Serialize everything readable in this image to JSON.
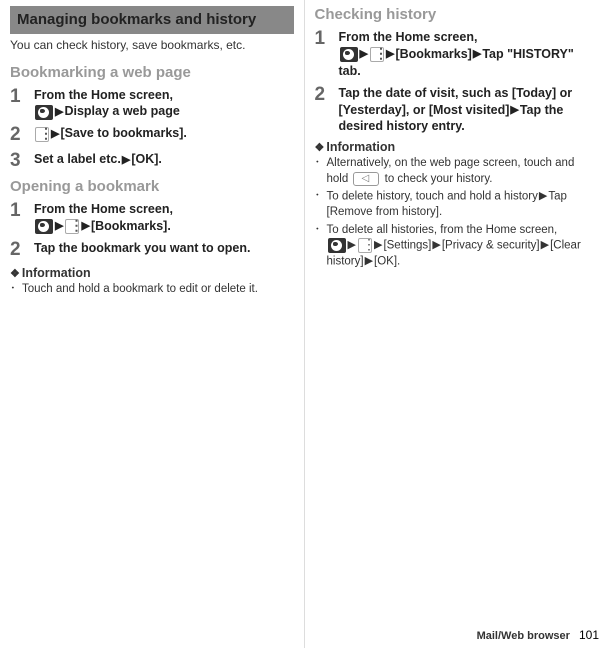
{
  "left": {
    "sectionTitle": "Managing bookmarks and history",
    "intro": "You can check history, save bookmarks, etc.",
    "sub1": "Bookmarking a web page",
    "steps1": {
      "s1a": "From the Home screen, ",
      "s1b": "Display a web page",
      "s2": "[Save to bookmarks].",
      "s3a": "Set a label etc.",
      "s3b": "[OK]."
    },
    "sub2": "Opening a bookmark",
    "steps2": {
      "s1a": "From the Home screen, ",
      "s1b": "[Bookmarks].",
      "s2": "Tap the bookmark you want to open."
    },
    "infoTitle": "Information",
    "bullet1": "Touch and hold a bookmark to edit or delete it."
  },
  "right": {
    "subheading": "Checking history",
    "steps": {
      "s1a": "From the Home screen, ",
      "s1b": "[Bookmarks]",
      "s1c": "Tap \"HISTORY\" tab.",
      "s2a": "Tap the date of visit, such as [Today] or [Yesterday], or [Most visited]",
      "s2b": "Tap the desired history entry."
    },
    "infoTitle": "Information",
    "bullets": {
      "b1a": "Alternatively, on the web page screen, touch and hold ",
      "b1b": " to check your history.",
      "b2a": "To delete history, touch and hold a history",
      "b2b": "Tap [Remove from history].",
      "b3a": "To delete all histories, from the Home screen, ",
      "b3b": "[Settings]",
      "b3c": "[Privacy & security]",
      "b3d": "[Clear history]",
      "b3e": "[OK]."
    }
  },
  "footer": {
    "chapter": "Mail/Web browser",
    "page": "101"
  }
}
